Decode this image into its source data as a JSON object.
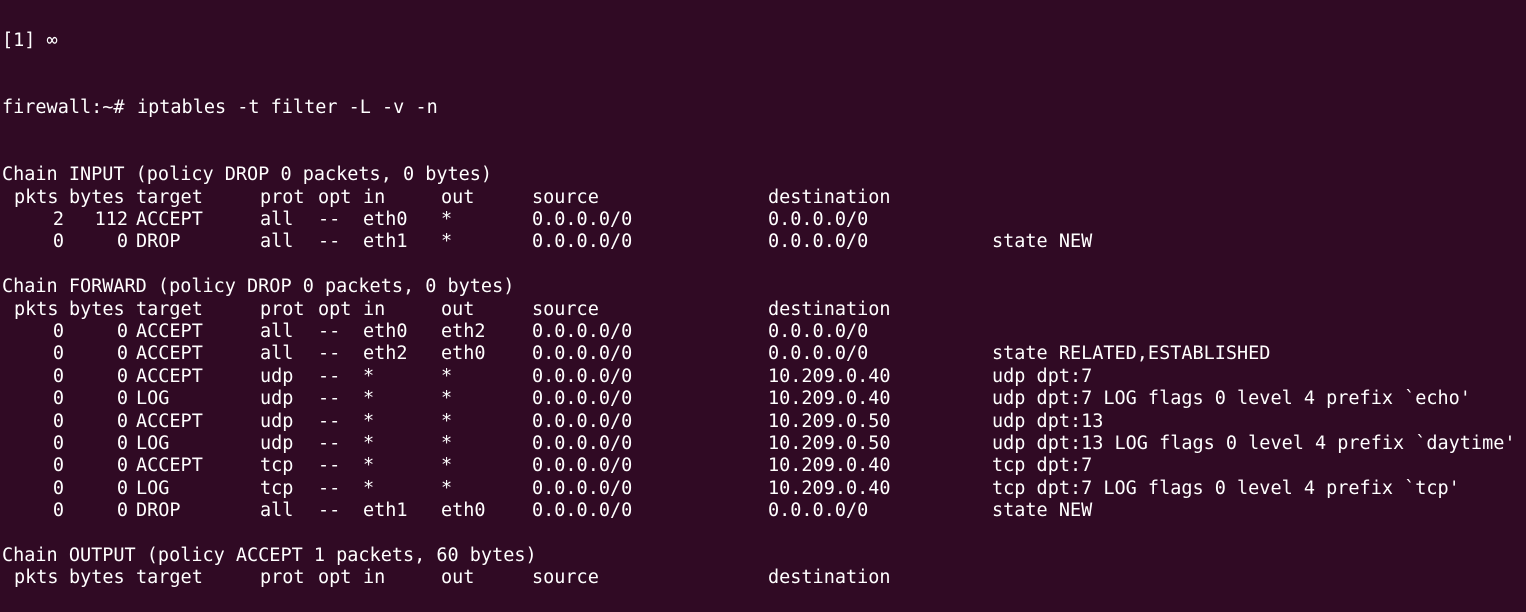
{
  "terminal": {
    "top_fragment": "[1] ∞",
    "prompt": "firewall:~#",
    "command": "iptables -t filter -L -v -n",
    "headers": {
      "pkts": "pkts",
      "bytes": "bytes",
      "target": "target",
      "prot": "prot",
      "opt": "opt",
      "in": "in",
      "out": "out",
      "source": "source",
      "destination": "destination"
    },
    "chains": [
      {
        "title": "Chain INPUT (policy DROP 0 packets, 0 bytes)",
        "rules": [
          {
            "pkts": "2",
            "bytes": "112",
            "target": "ACCEPT",
            "prot": "all",
            "opt": "--",
            "in": "eth0",
            "out": "*",
            "source": "0.0.0.0/0",
            "destination": "0.0.0.0/0",
            "extra": ""
          },
          {
            "pkts": "0",
            "bytes": "0",
            "target": "DROP",
            "prot": "all",
            "opt": "--",
            "in": "eth1",
            "out": "*",
            "source": "0.0.0.0/0",
            "destination": "0.0.0.0/0",
            "extra": "state NEW"
          }
        ]
      },
      {
        "title": "Chain FORWARD (policy DROP 0 packets, 0 bytes)",
        "rules": [
          {
            "pkts": "0",
            "bytes": "0",
            "target": "ACCEPT",
            "prot": "all",
            "opt": "--",
            "in": "eth0",
            "out": "eth2",
            "source": "0.0.0.0/0",
            "destination": "0.0.0.0/0",
            "extra": ""
          },
          {
            "pkts": "0",
            "bytes": "0",
            "target": "ACCEPT",
            "prot": "all",
            "opt": "--",
            "in": "eth2",
            "out": "eth0",
            "source": "0.0.0.0/0",
            "destination": "0.0.0.0/0",
            "extra": "state RELATED,ESTABLISHED"
          },
          {
            "pkts": "0",
            "bytes": "0",
            "target": "ACCEPT",
            "prot": "udp",
            "opt": "--",
            "in": "*",
            "out": "*",
            "source": "0.0.0.0/0",
            "destination": "10.209.0.40",
            "extra": "udp dpt:7"
          },
          {
            "pkts": "0",
            "bytes": "0",
            "target": "LOG",
            "prot": "udp",
            "opt": "--",
            "in": "*",
            "out": "*",
            "source": "0.0.0.0/0",
            "destination": "10.209.0.40",
            "extra": "udp dpt:7 LOG flags 0 level 4 prefix `echo'"
          },
          {
            "pkts": "0",
            "bytes": "0",
            "target": "ACCEPT",
            "prot": "udp",
            "opt": "--",
            "in": "*",
            "out": "*",
            "source": "0.0.0.0/0",
            "destination": "10.209.0.50",
            "extra": "udp dpt:13"
          },
          {
            "pkts": "0",
            "bytes": "0",
            "target": "LOG",
            "prot": "udp",
            "opt": "--",
            "in": "*",
            "out": "*",
            "source": "0.0.0.0/0",
            "destination": "10.209.0.50",
            "extra": "udp dpt:13 LOG flags 0 level 4 prefix `daytime'"
          },
          {
            "pkts": "0",
            "bytes": "0",
            "target": "ACCEPT",
            "prot": "tcp",
            "opt": "--",
            "in": "*",
            "out": "*",
            "source": "0.0.0.0/0",
            "destination": "10.209.0.40",
            "extra": "tcp dpt:7"
          },
          {
            "pkts": "0",
            "bytes": "0",
            "target": "LOG",
            "prot": "tcp",
            "opt": "--",
            "in": "*",
            "out": "*",
            "source": "0.0.0.0/0",
            "destination": "10.209.0.40",
            "extra": "tcp dpt:7 LOG flags 0 level 4 prefix `tcp'"
          },
          {
            "pkts": "0",
            "bytes": "0",
            "target": "DROP",
            "prot": "all",
            "opt": "--",
            "in": "eth1",
            "out": "eth0",
            "source": "0.0.0.0/0",
            "destination": "0.0.0.0/0",
            "extra": "state NEW"
          }
        ]
      },
      {
        "title": "Chain OUTPUT (policy ACCEPT 1 packets, 60 bytes)",
        "rules": []
      }
    ],
    "colors": {
      "background": "#300a24",
      "text": "#ffffff"
    }
  }
}
